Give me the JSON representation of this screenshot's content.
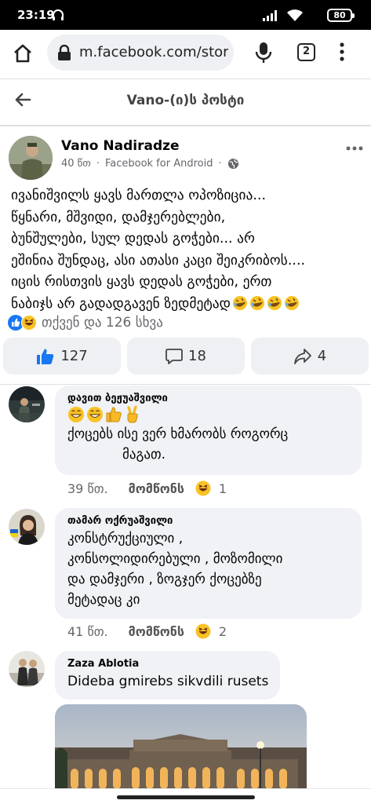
{
  "status_bar": {
    "time": "23:19",
    "battery": "80"
  },
  "browser": {
    "url": "m.facebook.com/stor",
    "tab_count": "2"
  },
  "page": {
    "title": "Vano-(ი)ს პოსტი"
  },
  "post": {
    "author": "Vano Nadiradze",
    "time": "40 წთ",
    "source": "Facebook for Android",
    "lines": [
      "ივანიშვილს ყავს მართლა ოპოზიცია...",
      "წყნარი, მშვიდი, დამჯერებლები,",
      "ბუნშულები,  სულ დედას გოჭები...  არ",
      "ეშინია შუნდაც, ასი ათასი კაცი შეიკრიბოს....",
      "იცის რისთვის ყავს დედას გოჭები, ერთ",
      "ნაბიჯს არ გადადგავენ ზედმეტად"
    ],
    "reactions_text": "თქვენ და 126 სხვა",
    "likes": "127",
    "comments": "18",
    "shares": "4"
  },
  "comments": [
    {
      "name": "დავით ბეჟუაშვილი",
      "lines": [
        "ქოცებს ისე ვერ ხმარობს როგორც",
        "მაგათ."
      ],
      "time": "39 წთ.",
      "like_label": "მომწონს",
      "reaction_count": "1"
    },
    {
      "name": "თამარ ოქრუაშვილი",
      "lines": [
        "კონსტრუქციული ,",
        "კონსოლიდირებული , მოზომილი",
        "და დამჯერი , ზოგჯერ ქოცებზე",
        "მეტადაც კი"
      ],
      "time": "41 წთ.",
      "like_label": "მომწონს",
      "reaction_count": "2"
    },
    {
      "name": "Zaza Ablotia",
      "lines": [
        "Dideba gmirebs sikvdili rusets"
      ]
    }
  ],
  "colors": {
    "facebook_blue": "#1877f2",
    "bubble_bg": "#f0f2f5",
    "meta_gray": "#65676b"
  },
  "icons": [
    "home-icon",
    "lock-icon",
    "mic-icon",
    "more-vert-icon",
    "back-arrow-icon",
    "globe-icon",
    "like-icon",
    "comment-icon",
    "share-icon",
    "haha-emoji-icon",
    "grin-emoji-icon",
    "thumbs-up-emoji-icon",
    "victory-hand-emoji-icon",
    "rofl-emoji-icon"
  ]
}
